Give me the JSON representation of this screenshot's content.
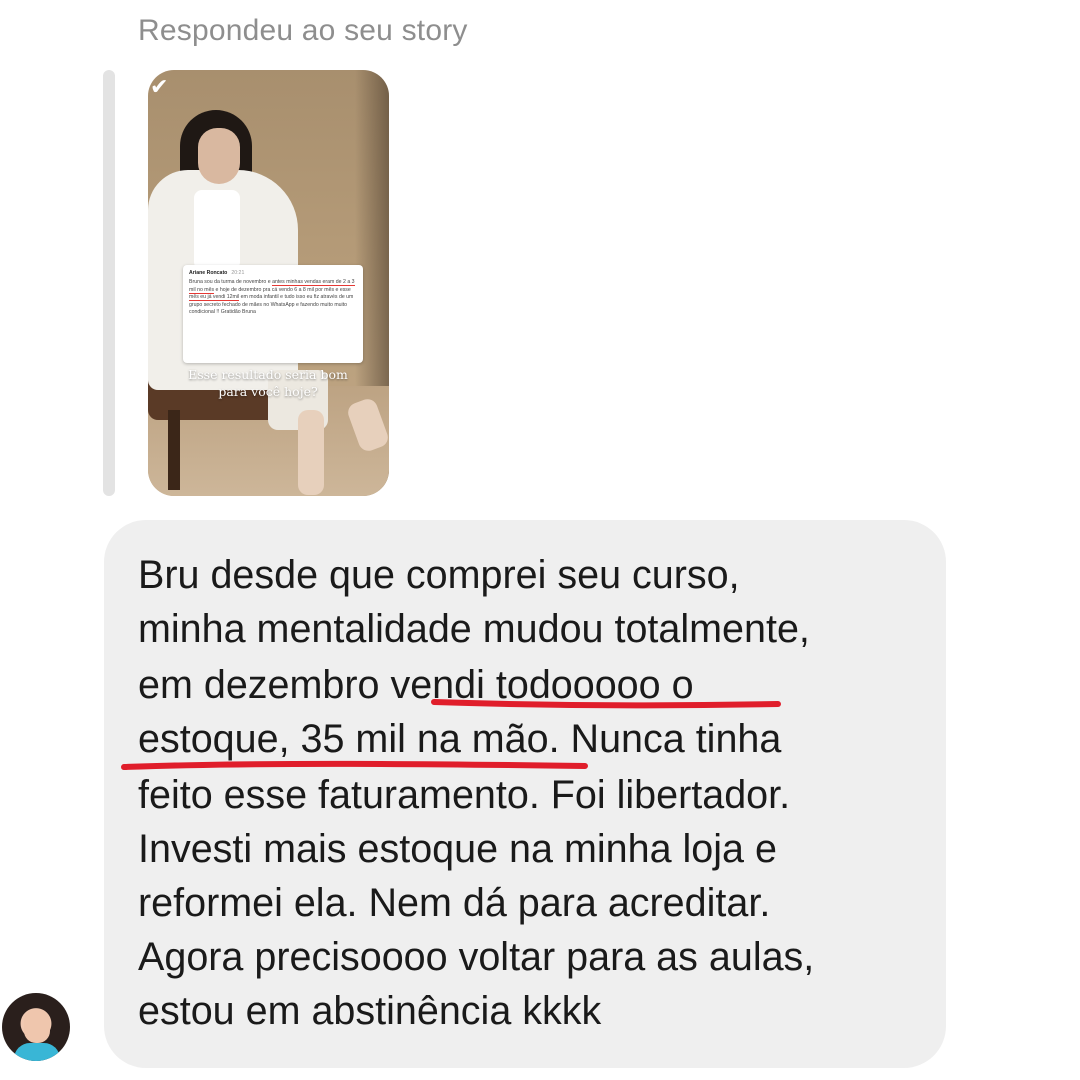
{
  "header": {
    "reply_label": "Respondeu ao seu story"
  },
  "story_preview": {
    "card": {
      "name": "Ariane Roncato",
      "time": "20:21",
      "text_part1": "Bruna sou da turma de novembro e ",
      "text_part2": "antes minhas vendas eram de 2 a 3 mil no mês",
      "text_part3": " e hoje de dezembro pra cá vendo 6 a 8 mil por mês e esse ",
      "text_part4": "mês eu já vendi 12mil",
      "text_part5": " em moda infantil e tudo isso eu fiz através de um grupo secreto fechado de mães no WhatsApp e fazendo muito muito condicional !! Gratidão Bruna"
    },
    "caption_line1": "Esse resultado seria bom",
    "caption_line2": "para você hoje?",
    "check_icon": "✔"
  },
  "message": {
    "lines": [
      "Bru desde que comprei seu curso,",
      "minha mentalidade mudou totalmente,",
      "em dezembro vendi todooooo o",
      "estoque, 35 mil na mão. Nunca tinha",
      "feito esse faturamento. Foi libertador.",
      "Investi mais estoque na minha loja e",
      "reformei ela. Nem dá para acreditar.",
      "Agora precisoooo voltar para as aulas,",
      "estou em abstinência kkkk"
    ],
    "highlight_color": "#e01e2b"
  },
  "colors": {
    "bubble": "#efefef",
    "label": "#8e8e8e",
    "text": "#1a1a1a"
  }
}
